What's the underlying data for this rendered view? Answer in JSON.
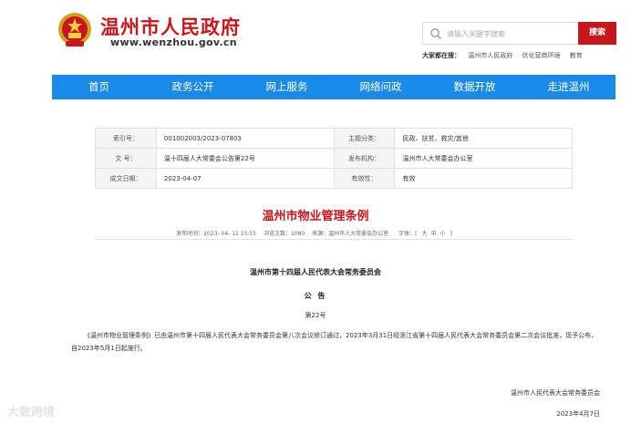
{
  "header": {
    "site_title": "温州市人民政府",
    "site_url": "www.wenzhou.gov.cn",
    "search_placeholder": "请输入关键字搜索",
    "search_button": "搜索",
    "hot_search_label": "大家都在搜：",
    "hot_search_items": [
      "温州市人民政府",
      "优化营商环境",
      "教育"
    ]
  },
  "nav": {
    "items": [
      "首页",
      "政务公开",
      "网上服务",
      "网络问政",
      "数据开放",
      "走进温州"
    ]
  },
  "info": {
    "index_label": "索引号：",
    "index_value": "001002003/2023-07803",
    "category_label": "主题分类：",
    "category_value": "民政、扶贫、救灾/其他",
    "docno_label": "文 号：",
    "docno_value": "温十四届人大常委会公告第22号",
    "org_label": "发布机构：",
    "org_value": "温州市人大常委会办公室",
    "date_label": "成文日期：",
    "date_value": "2023-04-07",
    "validity_label": "有效性：",
    "validity_value": "有效"
  },
  "article": {
    "title": "温州市物业管理条例",
    "meta_published": "发布时间：2023- 04- 11 15:55",
    "meta_views": "浏览次数：1080",
    "meta_source": "来源：温州市人大常委会办公室",
    "meta_size_prefix": "字体：[",
    "meta_size_large": "大",
    "meta_size_medium": "中",
    "meta_size_small": "小",
    "meta_size_suffix": "]",
    "issuer": "温州市第十四届人民代表大会常务委员会",
    "notice": "公 告",
    "notice_no": "第22号",
    "body": "《温州市物业管理条例》已由温州市第十四届人民代表大会常务委员会第八次会议修订通过，2023年3月31日经浙江省第十四届人民代表大会常务委员会第二次会议批准，现予公布，自2023年5月1日起施行。",
    "sign_org": "温州市人民代表大会常务委员会",
    "sign_date": "2023年4月7日"
  },
  "watermark": "大数跨境",
  "colors": {
    "brand_red": "#c8161d",
    "nav_blue": "#1a8ae8"
  }
}
